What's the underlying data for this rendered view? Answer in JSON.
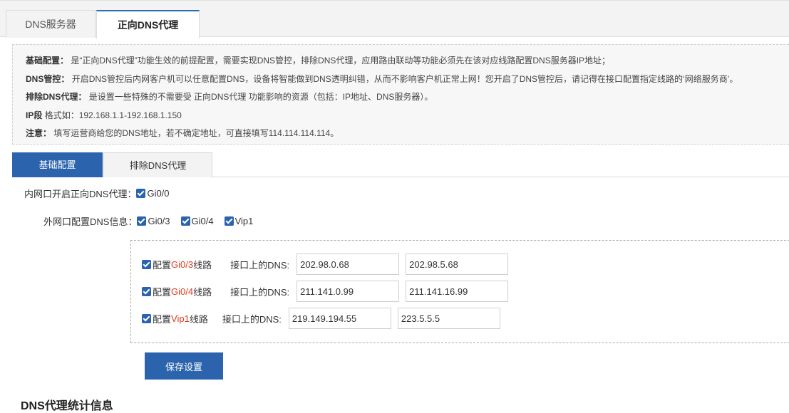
{
  "top_tabs": [
    "DNS服务器",
    "正向DNS代理"
  ],
  "info": {
    "lines": [
      {
        "label": "基础配置：",
        "text": "是“正向DNS代理”功能生效的前提配置，需要实现DNS管控，排除DNS代理，应用路由联动等功能必须先在该对应线路配置DNS服务器IP地址；"
      },
      {
        "label": "DNS管控：",
        "text": "开启DNS管控后内网客户机可以任意配置DNS，设备将智能做到DNS透明纠错，从而不影响客户机正常上网！您开启了DNS管控后，请记得在接口配置指定线路的‘网络服务商’。"
      },
      {
        "label": "排除DNS代理：",
        "text": "是设置一些特殊的不需要受 正向DNS代理 功能影响的资源（包括：IP地址、DNS服务器）。"
      },
      {
        "label": "IP段",
        "text": "格式如：192.168.1.1-192.168.1.150"
      },
      {
        "label": "注意：",
        "text": "填写运营商给您的DNS地址，若不确定地址，可直接填写114.114.114.114。"
      }
    ]
  },
  "sub_tabs": [
    "基础配置",
    "排除DNS代理"
  ],
  "inner": {
    "label": "内网口开启正向DNS代理：",
    "options": [
      "Gi0/0"
    ]
  },
  "outer": {
    "label": "外网口配置DNS信息：",
    "options": [
      "Gi0/3",
      "Gi0/4",
      "Vip1"
    ]
  },
  "dns_lines": [
    {
      "prefix": "配置",
      "iface": "Gi0/3",
      "suffix": "线路",
      "label": "接口上的DNS:",
      "dns1": "202.98.0.68",
      "dns2": "202.98.5.68"
    },
    {
      "prefix": "配置",
      "iface": "Gi0/4",
      "suffix": "线路",
      "label": "接口上的DNS:",
      "dns1": "211.141.0.99",
      "dns2": "211.141.16.99"
    },
    {
      "prefix": "配置",
      "iface": "Vip1",
      "suffix": "线路",
      "label": "接口上的DNS:",
      "dns1": "219.149.194.55",
      "dns2": "223.5.5.5"
    }
  ],
  "save_label": "保存设置",
  "stats_title": "DNS代理统计信息",
  "colors": {
    "primary": "#2b64ad",
    "accent_red": "#e03a1e"
  }
}
